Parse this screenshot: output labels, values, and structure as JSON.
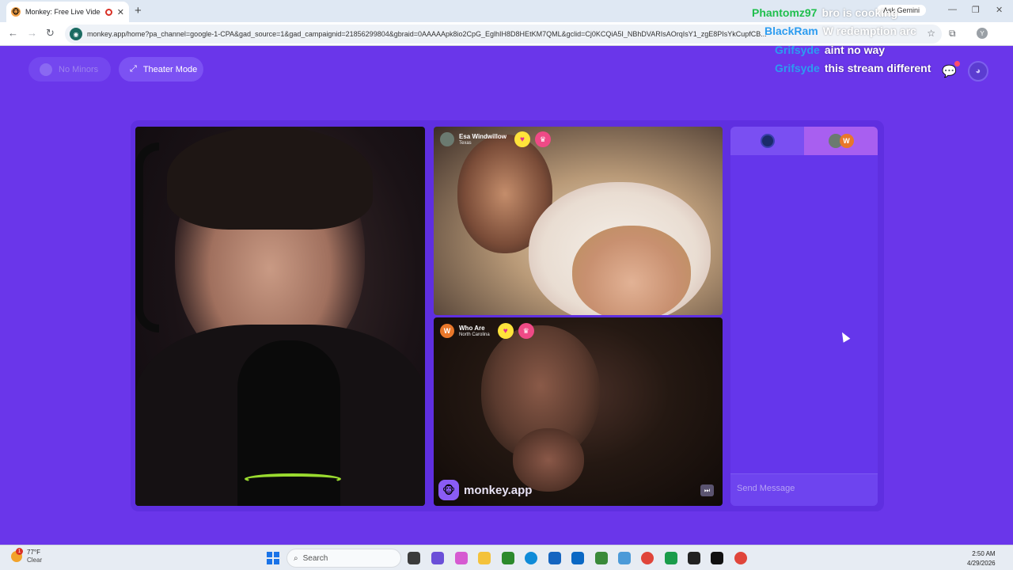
{
  "browser": {
    "tab_title": "Monkey: Free Live Video Chat",
    "new_tab": "+",
    "ask_gemini": "Ask Gemini",
    "url": "monkey.app/home?pa_channel=google-1-CPA&gad_source=1&gad_campaignid=21856299804&gbraid=0AAAAApk8io2CpG_EglhIH8D8HEtKM7QML&gclid=Cj0KCQiA5I_NBhDVARIsAOrqIsY1_zgE8PIsYkCupfCB...",
    "profile_initial": "Y",
    "window_controls": [
      "—",
      "❐",
      "✕"
    ]
  },
  "header": {
    "no_minors_label": "No Minors",
    "theater_label": "Theater Mode"
  },
  "overlay_chat": [
    {
      "user": "Phantomz97",
      "message": "bro is cooking",
      "user_color": "#1fbf4d"
    },
    {
      "user": "BlackRam",
      "message": "W redemption arc",
      "user_color": "#2c9cf0"
    },
    {
      "user": "Grifsyde",
      "message": "aint no way",
      "user_color": "#2c9cf0"
    },
    {
      "user": "Grifsyde",
      "message": "this stream different",
      "user_color": "#2c9cf0"
    }
  ],
  "participants": {
    "top": {
      "name": "Esa Windwillow",
      "location": "Texas"
    },
    "bottom": {
      "name": "Who Are",
      "location": "North Carolina",
      "initial": "W"
    }
  },
  "chat_panel": {
    "tab2_initial": "W",
    "send_placeholder": "Send Message"
  },
  "brand": {
    "text": "monkey.app",
    "icon": "🐵"
  },
  "taskbar": {
    "temp": "77°F",
    "condition": "Clear",
    "weather_badge": "1",
    "search_label": "Search",
    "time": "2:50 AM",
    "date": "4/29/2026"
  }
}
